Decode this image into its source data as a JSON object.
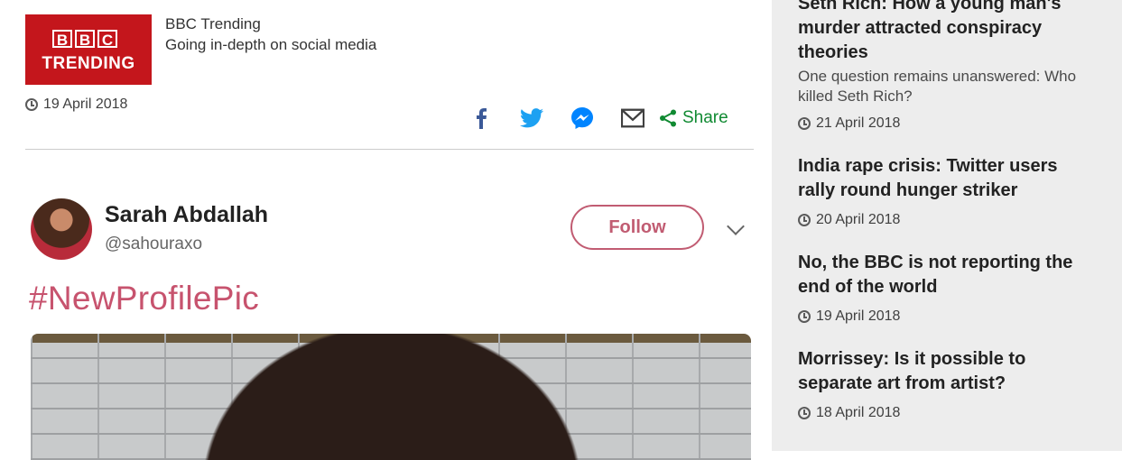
{
  "author": {
    "logo_letters": [
      "B",
      "B",
      "C"
    ],
    "logo_word": "TRENDING",
    "name": "BBC Trending",
    "description": "Going in-depth on social media"
  },
  "article": {
    "date": "19 April 2018",
    "share_label": "Share",
    "share_icons": [
      "facebook-icon",
      "twitter-icon",
      "messenger-icon",
      "email-icon",
      "share-icon"
    ]
  },
  "tweet": {
    "name": "Sarah Abdallah",
    "handle": "@sahouraxo",
    "follow_label": "Follow",
    "hashtag": "#NewProfilePic"
  },
  "sidebar": {
    "stories": [
      {
        "title": "Seth Rich: How a young man's murder attracted conspiracy theories",
        "summary": "One question remains unanswered: Who killed Seth Rich?",
        "date": "21 April 2018"
      },
      {
        "title": "India rape crisis: Twitter users rally round hunger striker",
        "summary": "",
        "date": "20 April 2018"
      },
      {
        "title": "No, the BBC is not reporting the end of the world",
        "summary": "",
        "date": "19 April 2018"
      },
      {
        "title": "Morrissey: Is it possible to separate art from artist?",
        "summary": "",
        "date": "18 April 2018"
      }
    ]
  },
  "colors": {
    "bbc_red": "#c4161c",
    "share_green": "#108a32",
    "twitter_pink": "#c15c72",
    "sidebar_bg": "#ededed"
  }
}
